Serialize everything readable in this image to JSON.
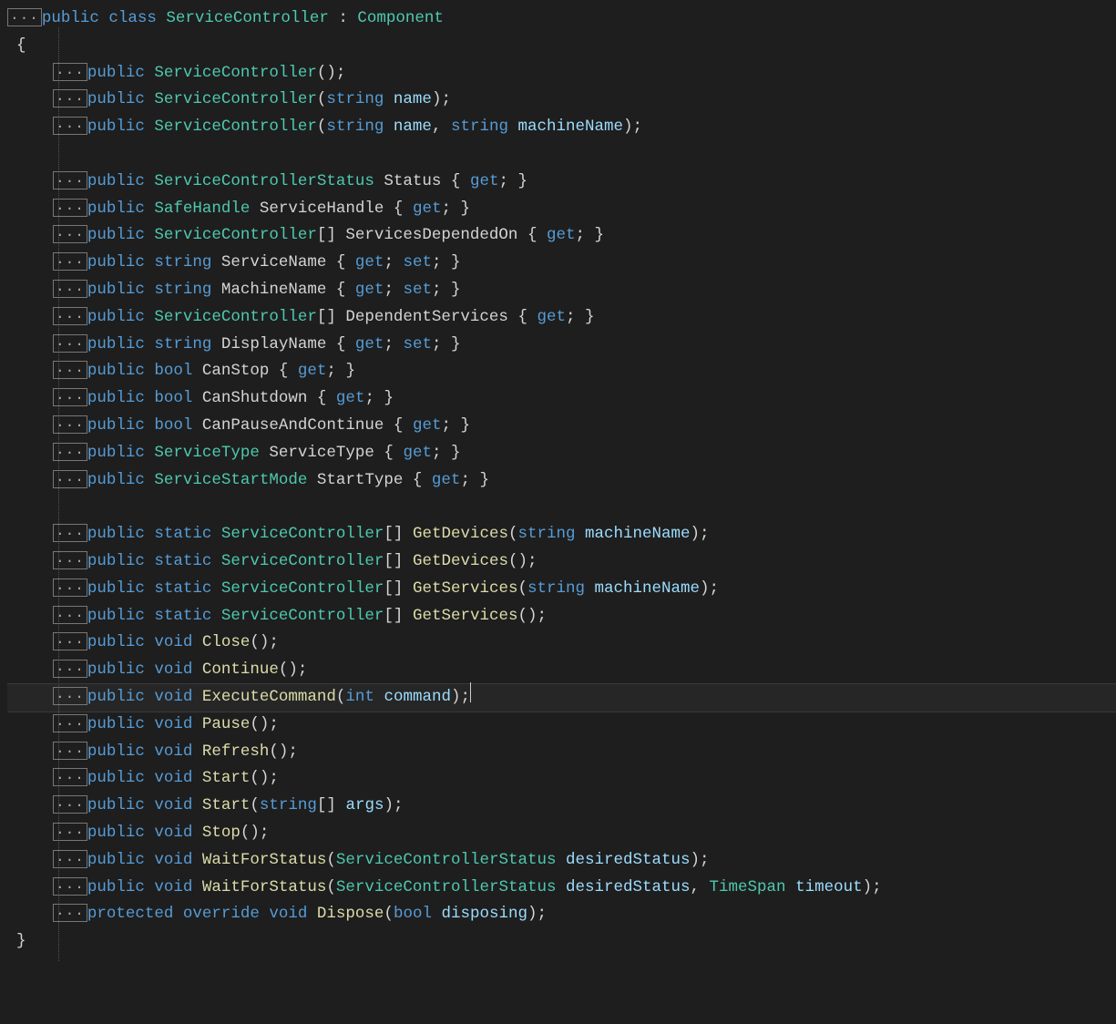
{
  "fold_label": "...",
  "brace_open": "{",
  "brace_close": "}",
  "decl": {
    "public": "public",
    "class": "class",
    "static": "static",
    "override": "override",
    "protected": "protected",
    "void": "void",
    "string": "string",
    "int": "int",
    "bool": "bool",
    "get": "get",
    "set": "set"
  },
  "types": {
    "ServiceController": "ServiceController",
    "Component": "Component",
    "ServiceControllerStatus": "ServiceControllerStatus",
    "SafeHandle": "SafeHandle",
    "ServiceType": "ServiceType",
    "ServiceStartMode": "ServiceStartMode",
    "TimeSpan": "TimeSpan"
  },
  "class_header_tokens": [
    "public",
    "class",
    "ServiceController",
    ":",
    "Component"
  ],
  "constructors": [
    {
      "params": []
    },
    {
      "params": [
        {
          "type": "string",
          "name": "name"
        }
      ]
    },
    {
      "params": [
        {
          "type": "string",
          "name": "name"
        },
        {
          "type": "string",
          "name": "machineName"
        }
      ]
    }
  ],
  "properties": [
    {
      "type": "ServiceControllerStatus",
      "name": "Status",
      "accessors": [
        "get"
      ]
    },
    {
      "type": "SafeHandle",
      "name": "ServiceHandle",
      "accessors": [
        "get"
      ]
    },
    {
      "type": "ServiceController[]",
      "name": "ServicesDependedOn",
      "accessors": [
        "get"
      ]
    },
    {
      "type": "string",
      "name": "ServiceName",
      "accessors": [
        "get",
        "set"
      ]
    },
    {
      "type": "string",
      "name": "MachineName",
      "accessors": [
        "get",
        "set"
      ]
    },
    {
      "type": "ServiceController[]",
      "name": "DependentServices",
      "accessors": [
        "get"
      ]
    },
    {
      "type": "string",
      "name": "DisplayName",
      "accessors": [
        "get",
        "set"
      ]
    },
    {
      "type": "bool",
      "name": "CanStop",
      "accessors": [
        "get"
      ]
    },
    {
      "type": "bool",
      "name": "CanShutdown",
      "accessors": [
        "get"
      ]
    },
    {
      "type": "bool",
      "name": "CanPauseAndContinue",
      "accessors": [
        "get"
      ]
    },
    {
      "type": "ServiceType",
      "name": "ServiceType",
      "accessors": [
        "get"
      ]
    },
    {
      "type": "ServiceStartMode",
      "name": "StartType",
      "accessors": [
        "get"
      ]
    }
  ],
  "methods": [
    {
      "mods": [
        "public",
        "static"
      ],
      "ret": "ServiceController[]",
      "name": "GetDevices",
      "params": [
        {
          "type": "string",
          "name": "machineName"
        }
      ]
    },
    {
      "mods": [
        "public",
        "static"
      ],
      "ret": "ServiceController[]",
      "name": "GetDevices",
      "params": []
    },
    {
      "mods": [
        "public",
        "static"
      ],
      "ret": "ServiceController[]",
      "name": "GetServices",
      "params": [
        {
          "type": "string",
          "name": "machineName"
        }
      ]
    },
    {
      "mods": [
        "public",
        "static"
      ],
      "ret": "ServiceController[]",
      "name": "GetServices",
      "params": []
    },
    {
      "mods": [
        "public"
      ],
      "ret": "void",
      "name": "Close",
      "params": []
    },
    {
      "mods": [
        "public"
      ],
      "ret": "void",
      "name": "Continue",
      "params": []
    },
    {
      "mods": [
        "public"
      ],
      "ret": "void",
      "name": "ExecuteCommand",
      "params": [
        {
          "type": "int",
          "name": "command"
        }
      ],
      "highlight": true,
      "cursor_after": true
    },
    {
      "mods": [
        "public"
      ],
      "ret": "void",
      "name": "Pause",
      "params": []
    },
    {
      "mods": [
        "public"
      ],
      "ret": "void",
      "name": "Refresh",
      "params": []
    },
    {
      "mods": [
        "public"
      ],
      "ret": "void",
      "name": "Start",
      "params": []
    },
    {
      "mods": [
        "public"
      ],
      "ret": "void",
      "name": "Start",
      "params": [
        {
          "type": "string[]",
          "name": "args"
        }
      ]
    },
    {
      "mods": [
        "public"
      ],
      "ret": "void",
      "name": "Stop",
      "params": []
    },
    {
      "mods": [
        "public"
      ],
      "ret": "void",
      "name": "WaitForStatus",
      "params": [
        {
          "type": "ServiceControllerStatus",
          "name": "desiredStatus"
        }
      ]
    },
    {
      "mods": [
        "public"
      ],
      "ret": "void",
      "name": "WaitForStatus",
      "params": [
        {
          "type": "ServiceControllerStatus",
          "name": "desiredStatus"
        },
        {
          "type": "TimeSpan",
          "name": "timeout"
        }
      ]
    },
    {
      "mods": [
        "protected",
        "override"
      ],
      "ret": "void",
      "name": "Dispose",
      "params": [
        {
          "type": "bool",
          "name": "disposing"
        }
      ]
    }
  ]
}
